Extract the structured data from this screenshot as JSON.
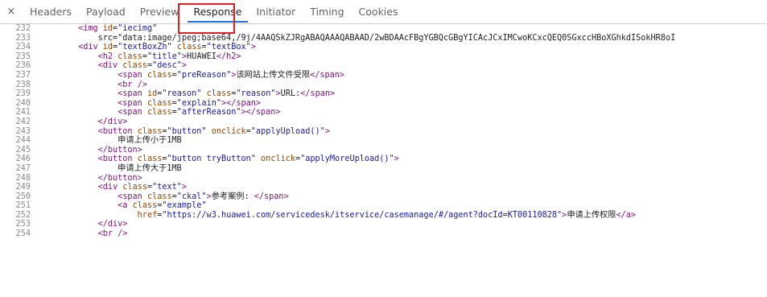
{
  "tabs": [
    {
      "label": "Headers",
      "active": false
    },
    {
      "label": "Payload",
      "active": false
    },
    {
      "label": "Preview",
      "active": false
    },
    {
      "label": "Response",
      "active": true
    },
    {
      "label": "Initiator",
      "active": false
    },
    {
      "label": "Timing",
      "active": false
    },
    {
      "label": "Cookies",
      "active": false
    }
  ],
  "close_icon_glyph": "×",
  "colors": {
    "tag": "#881280",
    "attr": "#994500",
    "value": "#1a1aa6",
    "highlight": "#e02020"
  },
  "code_lines": [
    {
      "n": "232",
      "text": "        <img id=\"iecimg\""
    },
    {
      "n": "233",
      "text": "            src=\"data:image/jpeg;base64,/9j/4AAQSkZJRgABAQAAAQABAAD/2wBDAAcFBgYGBQcGBgYICAcJCxIMCwoKCxcQEQ0SGxccHBoXGhkdISokHR8oI"
    },
    {
      "n": "234",
      "text": "        <div id=\"textBoxZh\" class=\"textBox\">"
    },
    {
      "n": "235",
      "text": "            <h2 class=\"title\">HUAWEI</h2>"
    },
    {
      "n": "236",
      "text": "            <div class=\"desc\">"
    },
    {
      "n": "237",
      "text": "                <span class=\"preReason\">该网站上传文件受限</span>"
    },
    {
      "n": "238",
      "text": "                <br />"
    },
    {
      "n": "239",
      "text": "                <span id=\"reason\" class=\"reason\">URL:</span>"
    },
    {
      "n": "240",
      "text": "                <span class=\"explain\"></span>"
    },
    {
      "n": "241",
      "text": "                <span class=\"afterReason\"></span>"
    },
    {
      "n": "242",
      "text": "            </div>"
    },
    {
      "n": "243",
      "text": "            <button class=\"button\" onclick=\"applyUpload()\">"
    },
    {
      "n": "244",
      "text": "                申请上传小于1MB"
    },
    {
      "n": "245",
      "text": "            </button>"
    },
    {
      "n": "246",
      "text": "            <button class=\"button tryButton\" onclick=\"applyMoreUpload()\">"
    },
    {
      "n": "247",
      "text": "                申请上传大于1MB"
    },
    {
      "n": "248",
      "text": "            </button>"
    },
    {
      "n": "249",
      "text": "            <div class=\"text\">"
    },
    {
      "n": "250",
      "text": "                <span class=\"ckal\">参考案例: </span>"
    },
    {
      "n": "251",
      "text": "                <a class=\"example\""
    },
    {
      "n": "252",
      "text": "                    href=\"https://w3.huawei.com/servicedesk/itservice/casemanage/#/agent?docId=KT00110828\">申请上传权限</a>"
    },
    {
      "n": "253",
      "text": "            </div>"
    },
    {
      "n": "254",
      "text": "            <br />"
    }
  ]
}
